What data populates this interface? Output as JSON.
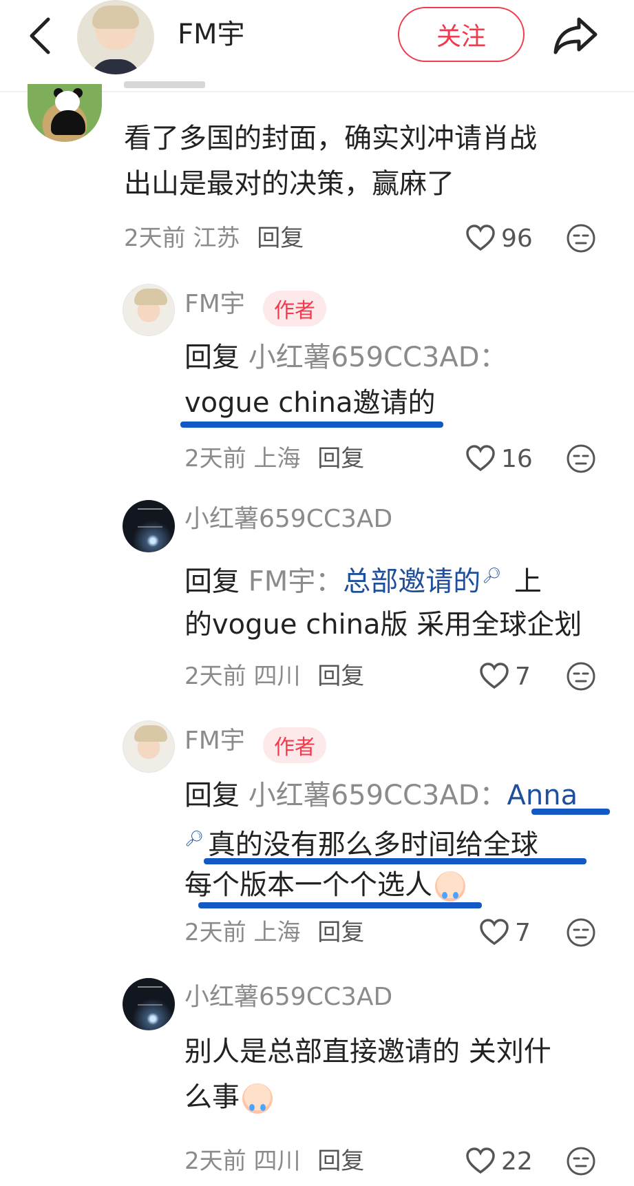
{
  "header": {
    "name": "FM宇",
    "follow_label": "关注"
  },
  "comments": [
    {
      "text_lines": [
        "看了多国的封面，确实刘冲请肖战",
        "出山是最对的决策，赢麻了"
      ],
      "time": "2天前",
      "location": "江苏",
      "reply_label": "回复",
      "likes": "96"
    },
    {
      "username": "FM宇",
      "badge": "作者",
      "reply_kw": "回复",
      "reply_target": "小红薯659CC3AD：",
      "text_lines": [
        "vogue china邀请的"
      ],
      "time": "2天前",
      "location": "上海",
      "reply_label": "回复",
      "likes": "16"
    },
    {
      "username": "小红薯659CC3AD",
      "reply_kw": "回复",
      "reply_target": "FM宇：",
      "link_text": "总部邀请的",
      "line1_tail": "上",
      "line2": "的vogue china版  采用全球企划",
      "time": "2天前",
      "location": "四川",
      "reply_label": "回复",
      "likes": "7"
    },
    {
      "username": "FM宇",
      "badge": "作者",
      "reply_kw": "回复",
      "reply_target": "小红薯659CC3AD：",
      "link_text": "Anna",
      "line2": "真的没有那么多时间给全球",
      "line3": "每个版本一个个选人",
      "time": "2天前",
      "location": "上海",
      "reply_label": "回复",
      "likes": "7"
    },
    {
      "username": "小红薯659CC3AD",
      "text_lines": [
        "别人是总部直接邀请的 关刘什",
        "么事"
      ],
      "time": "2天前",
      "location": "四川",
      "reply_label": "回复",
      "likes": "22"
    }
  ]
}
